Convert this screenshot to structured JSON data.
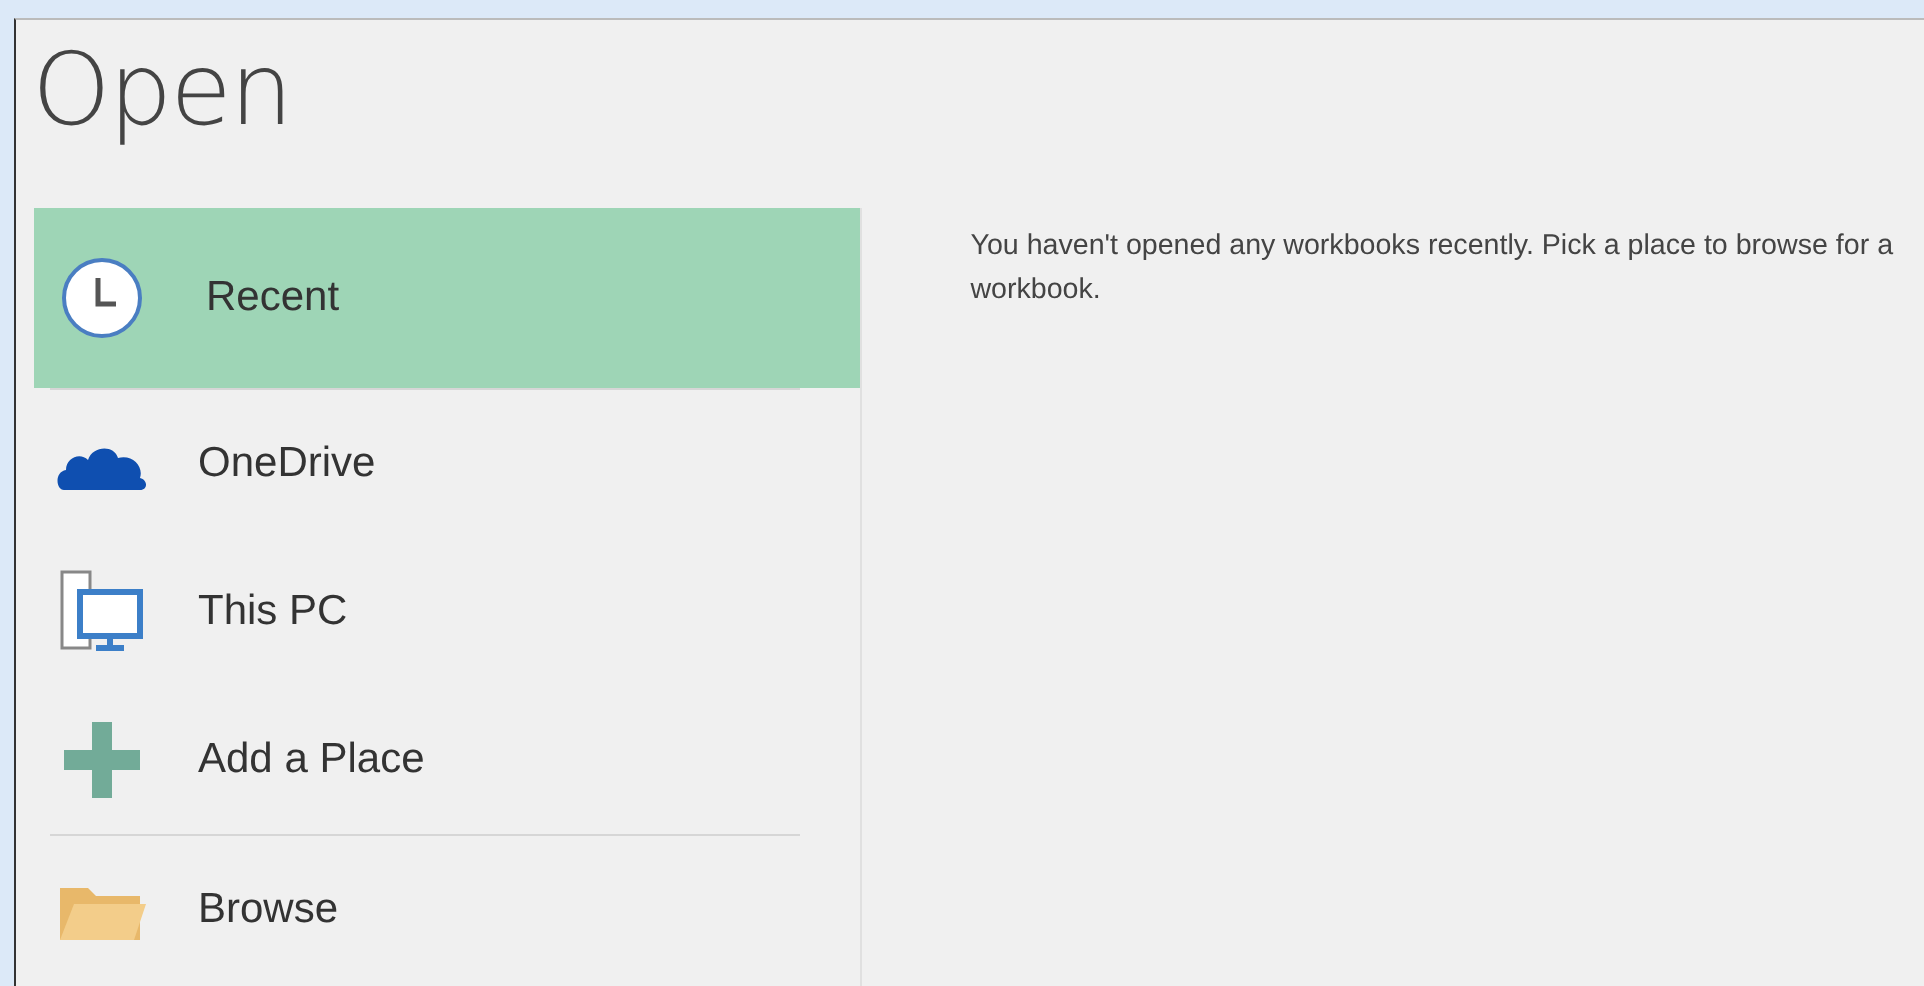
{
  "title": "Open",
  "places": [
    {
      "kind": "clock",
      "label": "Recent",
      "selected": true,
      "divider_after": true
    },
    {
      "kind": "cloud",
      "label": "OneDrive",
      "selected": false,
      "divider_after": false
    },
    {
      "kind": "computer",
      "label": "This PC",
      "selected": false,
      "divider_after": false
    },
    {
      "kind": "plus",
      "label": "Add a Place",
      "selected": false,
      "divider_after": true
    },
    {
      "kind": "folder",
      "label": "Browse",
      "selected": false,
      "divider_after": false
    }
  ],
  "message": "You haven't opened any workbooks recently. Pick a place to browse for a workbook."
}
